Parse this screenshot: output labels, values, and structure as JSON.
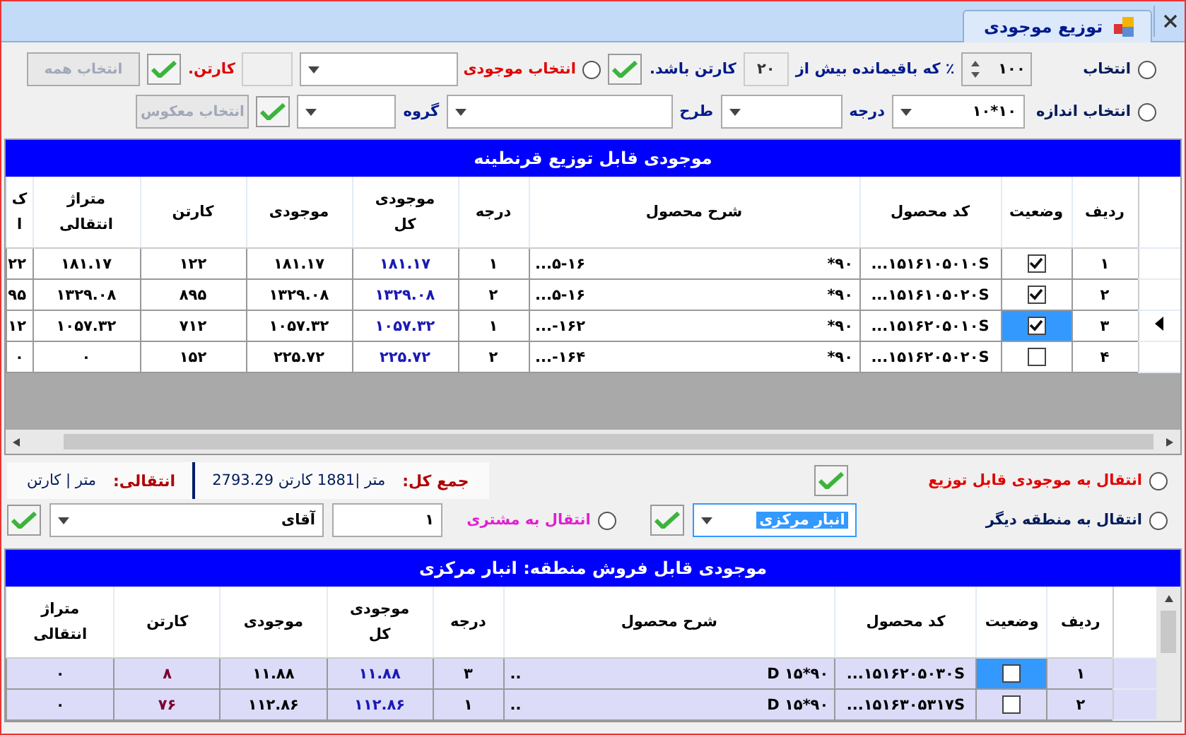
{
  "window": {
    "tab": {
      "label": "توزیع موجودی",
      "selected": true
    }
  },
  "filters": {
    "row1": {
      "radio": {
        "label": "انتخاب",
        "selected": false
      },
      "spinner": "۱۰۰",
      "text_before": "٪ که باقیمانده بیش از",
      "cartons": "۲۰",
      "text_after": "کارتن باشد.",
      "stock_radio": {
        "label": "انتخاب موجودی",
        "selected": false
      },
      "unit": "کارتن.",
      "button": {
        "label": "انتخاب همه",
        "disabled": true
      }
    },
    "row2": {
      "radio": {
        "label": "انتخاب اندازه",
        "selected": false
      },
      "size": "۱۰*۱۰",
      "grade_label": "درجه",
      "design_label": "طرح",
      "group_label": "گروه",
      "button": {
        "label": "انتخاب معکوس",
        "disabled": true
      }
    }
  },
  "upper_grid": {
    "title": "موجودی قابل توزیع قرنطینه",
    "columns": [
      [
        "ردیف"
      ],
      [
        "وضعیت"
      ],
      [
        "کد محصول"
      ],
      [
        "شرح محصول"
      ],
      [
        "درجه"
      ],
      [
        "موجودی",
        "کل"
      ],
      [
        "موجودی"
      ],
      [
        "کارتن"
      ],
      [
        "متراژ",
        "انتقالی"
      ],
      [
        "ک",
        "ا"
      ]
    ],
    "rows": [
      {
        "current": false,
        "selected": false,
        "index": "۱",
        "checked": true,
        "code": "...۱۵۱۶۱۰۵۰۱۰S",
        "desc_right": "*۹۰",
        "desc_left": "...۵-۱۶",
        "values": [
          "۱",
          "۱۸۱.۱۷",
          "۱۸۱.۱۷",
          "۱۲۲",
          "۱۸۱.۱۷",
          "۲۲"
        ]
      },
      {
        "current": false,
        "selected": false,
        "index": "۲",
        "checked": true,
        "code": "...۱۵۱۶۱۰۵۰۲۰S",
        "desc_right": "*۹۰",
        "desc_left": "...۵-۱۶",
        "values": [
          "۲",
          "۱۳۲۹.۰۸",
          "۱۳۲۹.۰۸",
          "۸۹۵",
          "۱۳۲۹.۰۸",
          "۹۵"
        ]
      },
      {
        "current": true,
        "selected": true,
        "index": "۳",
        "checked": true,
        "code": "...۱۵۱۶۲۰۵۰۱۰S",
        "desc_right": "*۹۰",
        "desc_left": "...-۱۶۲",
        "values": [
          "۱",
          "۱۰۵۷.۳۲",
          "۱۰۵۷.۳۲",
          "۷۱۲",
          "۱۰۵۷.۳۲",
          "۱۲"
        ]
      },
      {
        "current": false,
        "selected": false,
        "index": "۴",
        "checked": false,
        "code": "...۱۵۱۶۲۰۵۰۲۰S",
        "desc_right": "*۹۰",
        "desc_left": "...-۱۶۴",
        "values": [
          "۲",
          "۲۲۵.۷۲",
          "۲۲۵.۷۲",
          "۱۵۲",
          "۰",
          "۰"
        ]
      }
    ]
  },
  "transfer": {
    "to_distribution": {
      "label": "انتقال به موجودی قابل توزیع",
      "selected": false
    },
    "to_zone": {
      "label": "انتقال به منطقه دیگر",
      "selected": false,
      "value": "انبار مرکزی"
    },
    "to_customer": {
      "label": "انتقال به مشتری",
      "selected": false,
      "quantity": "۱",
      "customer": "آقای"
    },
    "total_label": "جمع کل:",
    "total_value": "2793.29 متر |1881 کارتن",
    "moved_label": "انتقالی:",
    "moved_value": "متر | کارتن"
  },
  "lower_grid": {
    "title": "موجودی قابل فروش منطقه: انبار مرکزی",
    "columns": [
      [
        "ردیف"
      ],
      [
        "وضعیت"
      ],
      [
        "کد محصول"
      ],
      [
        "شرح محصول"
      ],
      [
        "درجه"
      ],
      [
        "موجودی",
        "کل"
      ],
      [
        "موجودی"
      ],
      [
        "کارتن"
      ],
      [
        "متراژ",
        "انتقالی"
      ]
    ],
    "rows": [
      {
        "current": false,
        "selected": true,
        "index": "۱",
        "checked": false,
        "code": "...۱۵۱۶۲۰۵۰۳۰S",
        "desc_right": "D ۱۵*۹۰",
        "desc_left": "..",
        "values": [
          "۳",
          "۱۱.۸۸",
          "۱۱.۸۸",
          "۸",
          "۰"
        ]
      },
      {
        "current": false,
        "selected": false,
        "index": "۲",
        "checked": false,
        "code": "...۱۵۱۶۳۰۵۳۱۷S",
        "desc_right": "D ۱۵*۹۰",
        "desc_left": "..",
        "values": [
          "۱",
          "۱۱۲.۸۶",
          "۱۱۲.۸۶",
          "۷۶",
          "۰"
        ]
      }
    ]
  }
}
